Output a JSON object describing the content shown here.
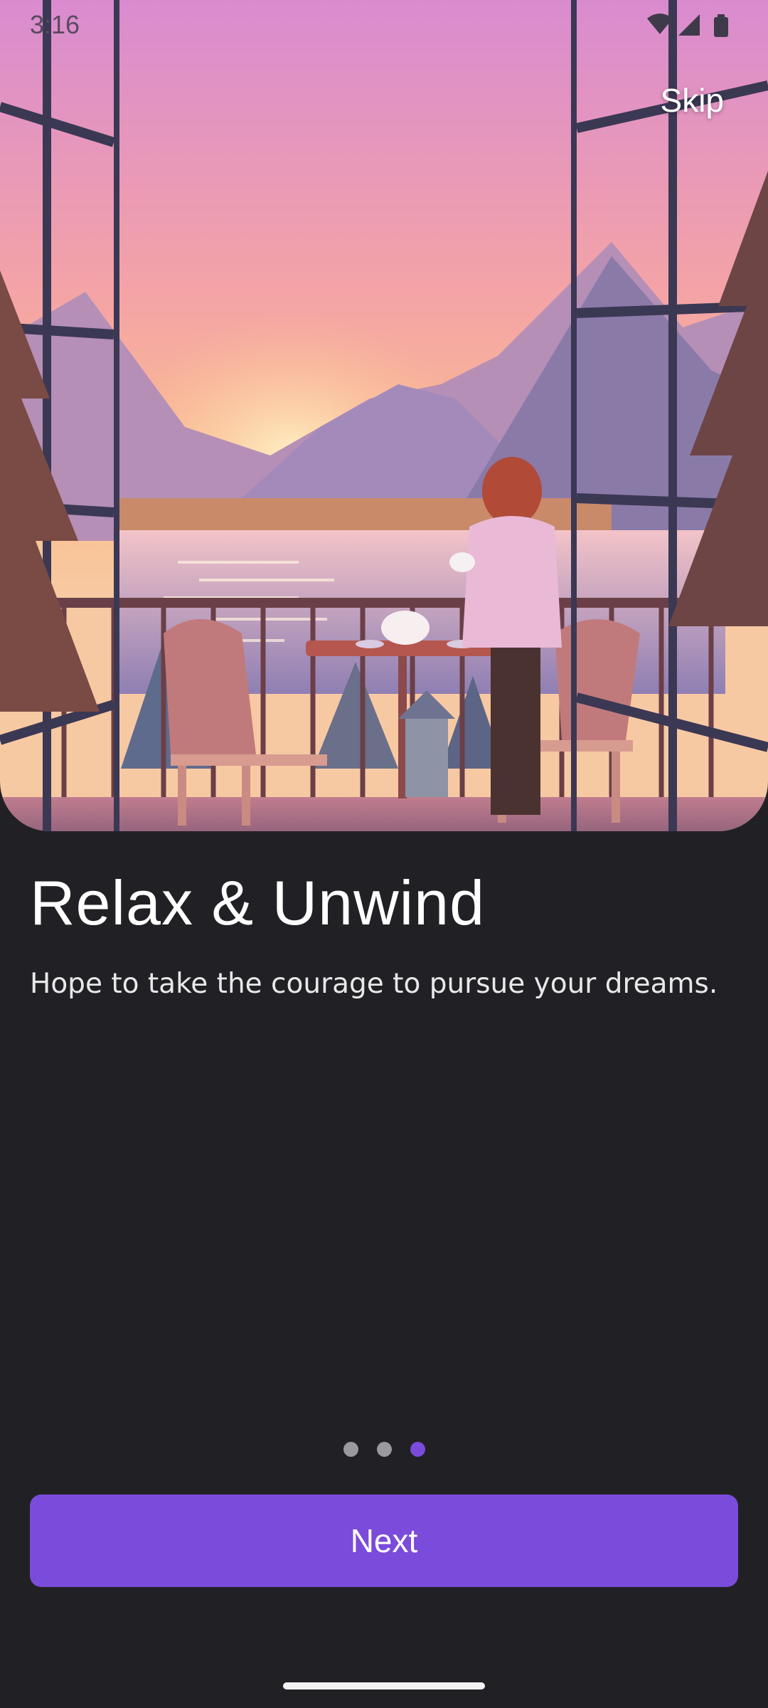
{
  "status_bar": {
    "time": "3:16",
    "icons": [
      "wifi-icon",
      "cellular-signal-icon",
      "battery-icon"
    ]
  },
  "onboarding": {
    "skip_label": "Skip",
    "title": "Relax & Unwind",
    "subtitle": "Hope to take the courage to pursue your dreams.",
    "page_indicator": {
      "total": 3,
      "current": 3
    },
    "next_label": "Next"
  },
  "colors": {
    "background": "#212125",
    "accent": "#7b4bdb",
    "inactive_dot": "#9a9a9e"
  }
}
